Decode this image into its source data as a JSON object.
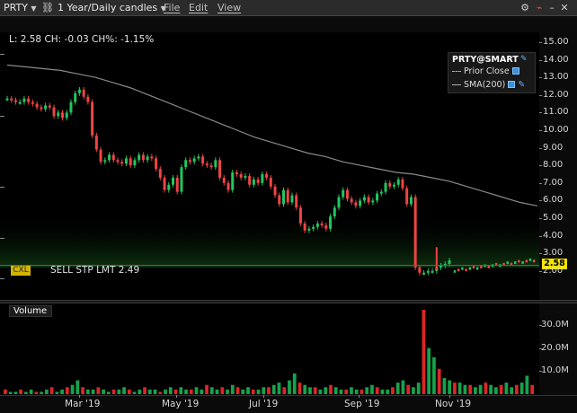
{
  "toolbar": {
    "symbol": "PRTY",
    "period": "1 Year/Daily candles",
    "menus": [
      "File",
      "Edit",
      "View"
    ]
  },
  "quote_line": "L: 2.58 CH: -0.03 CH%: -1.15%",
  "legend": {
    "title": "PRTY@SMART",
    "rows": [
      "Prior Close",
      "SMA(200)"
    ]
  },
  "order": {
    "cxl": "CXL",
    "label": "SELL STP LMT 2.49"
  },
  "last_price_tag": "2.58",
  "volume_title": "Volume",
  "colors": {
    "up": "#22c55e",
    "down": "#ef4444",
    "sma": "#8a8a8a",
    "order_line": "#c83232",
    "price_tag": "#f2e400",
    "volume_up": "#16a34a",
    "volume_down": "#dc2626"
  },
  "chart_data": {
    "type": "candlestick",
    "y_axis": [
      "15.00",
      "14.00",
      "13.00",
      "12.00",
      "11.00",
      "10.00",
      "9.00",
      "8.00",
      "7.00",
      "6.00",
      "5.00",
      "4.00",
      "3.00",
      "2.00"
    ],
    "volume_axis": [
      "30.0M",
      "20.0M",
      "10.0M"
    ],
    "x_axis": [
      "Mar '19",
      "May '19",
      "Jul '19",
      "Sep '19",
      "Nov '19"
    ],
    "price_series": [
      11.8,
      11.7,
      11.6,
      11.6,
      11.8,
      11.6,
      11.5,
      11.3,
      11.2,
      11.4,
      11.3,
      10.8,
      11.0,
      10.7,
      11.0,
      11.6,
      12.1,
      12.3,
      11.9,
      11.6,
      9.7,
      8.9,
      8.2,
      8.3,
      8.6,
      8.3,
      8.2,
      8.1,
      8.4,
      8.0,
      8.3,
      8.6,
      8.3,
      8.5,
      8.4,
      7.8,
      7.3,
      6.6,
      6.9,
      7.3,
      6.5,
      7.9,
      8.3,
      8.2,
      8.4,
      8.5,
      8.1,
      8.0,
      7.9,
      8.3,
      7.3,
      7.0,
      6.6,
      7.6,
      7.5,
      7.3,
      7.4,
      6.9,
      7.2,
      7.0,
      7.5,
      7.3,
      6.8,
      6.3,
      5.8,
      6.6,
      5.9,
      6.3,
      5.6,
      4.7,
      4.3,
      4.4,
      4.5,
      4.7,
      4.6,
      4.4,
      5.1,
      5.6,
      6.2,
      6.6,
      6.1,
      5.9,
      5.7,
      6.0,
      6.2,
      5.9,
      6.0,
      6.4,
      6.5,
      7.0,
      6.8,
      6.9,
      7.2,
      6.7,
      5.8,
      6.2,
      2.2,
      1.9,
      1.9,
      2.0,
      2.0,
      2.2,
      2.3,
      2.4,
      2.6
    ],
    "sma_200": [
      13.7,
      13.6,
      13.5,
      13.4,
      13.2,
      13.0,
      12.7,
      12.4,
      12.0,
      11.6,
      11.2,
      10.8,
      10.4,
      10.0,
      9.6,
      9.3,
      9.0,
      8.7,
      8.5,
      8.2,
      8.0,
      7.8,
      7.6,
      7.5,
      7.3,
      7.1,
      6.8,
      6.5,
      6.2,
      5.9,
      5.7
    ],
    "volume": [
      2,
      1,
      1,
      2,
      1,
      2,
      1,
      1,
      2,
      3,
      1,
      2,
      3,
      4,
      6,
      3,
      2,
      2,
      3,
      2,
      1,
      2,
      2,
      3,
      2,
      1,
      2,
      3,
      2,
      2,
      1,
      2,
      3,
      2,
      3,
      2,
      2,
      3,
      2,
      4,
      3,
      2,
      3,
      2,
      4,
      3,
      2,
      3,
      2,
      2,
      3,
      3,
      4,
      5,
      3,
      6,
      9,
      5,
      4,
      3,
      3,
      2,
      3,
      4,
      3,
      2,
      2,
      3,
      2,
      2,
      3,
      4,
      3,
      2,
      2,
      3,
      5,
      6,
      4,
      3,
      5,
      40,
      20,
      16,
      11,
      7,
      6,
      5,
      5,
      4,
      4,
      3,
      4,
      5,
      4,
      3,
      4,
      5,
      3,
      4,
      5,
      8,
      4
    ]
  }
}
